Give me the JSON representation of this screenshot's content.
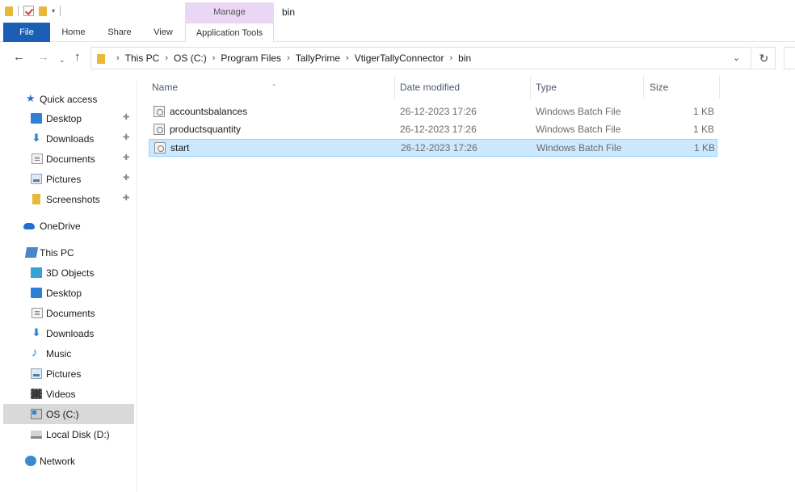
{
  "titlebar": {
    "manage_label": "Manage",
    "window_title": "bin",
    "qat_customize": "▾"
  },
  "ribbon": {
    "tabs": [
      "File",
      "Home",
      "Share",
      "View"
    ],
    "context_tab": "Application Tools",
    "accent": "#1a5fb4",
    "context_color": "#ead7f5"
  },
  "navigation": {
    "back": "←",
    "forward": "→",
    "recent": "⌄",
    "up": "↑",
    "refresh": "↻",
    "dropdown": "⌄"
  },
  "address": {
    "crumbs": [
      "This PC",
      "OS (C:)",
      "Program Files",
      "TallyPrime",
      "VtigerTallyConnector",
      "bin"
    ],
    "separator": "›"
  },
  "sidebar": {
    "quick_access": {
      "label": "Quick access",
      "items": [
        {
          "label": "Desktop",
          "icon": "desktop-icon",
          "pinned": true
        },
        {
          "label": "Downloads",
          "icon": "download-icon",
          "pinned": true
        },
        {
          "label": "Documents",
          "icon": "documents-icon",
          "pinned": true
        },
        {
          "label": "Pictures",
          "icon": "pictures-icon",
          "pinned": true
        },
        {
          "label": "Screenshots",
          "icon": "folder-icon",
          "pinned": true
        }
      ]
    },
    "onedrive": {
      "label": "OneDrive"
    },
    "this_pc": {
      "label": "This PC",
      "items": [
        {
          "label": "3D Objects",
          "icon": "3d-objects-icon"
        },
        {
          "label": "Desktop",
          "icon": "desktop-icon"
        },
        {
          "label": "Documents",
          "icon": "documents-icon"
        },
        {
          "label": "Downloads",
          "icon": "download-icon"
        },
        {
          "label": "Music",
          "icon": "music-icon"
        },
        {
          "label": "Pictures",
          "icon": "pictures-icon"
        },
        {
          "label": "Videos",
          "icon": "videos-icon"
        },
        {
          "label": "OS (C:)",
          "icon": "drive-icon",
          "selected": true
        },
        {
          "label": "Local Disk (D:)",
          "icon": "disk-icon"
        }
      ]
    },
    "network": {
      "label": "Network"
    },
    "pin_glyph": "📌"
  },
  "filelist": {
    "columns": {
      "name": "Name",
      "date": "Date modified",
      "type": "Type",
      "size": "Size"
    },
    "sort_glyph": "⌃",
    "files": [
      {
        "name": "accountsbalances",
        "date": "26-12-2023 17:26",
        "type": "Windows Batch File",
        "size": "1 KB",
        "selected": false
      },
      {
        "name": "productsquantity",
        "date": "26-12-2023 17:26",
        "type": "Windows Batch File",
        "size": "1 KB",
        "selected": false
      },
      {
        "name": "start",
        "date": "26-12-2023 17:26",
        "type": "Windows Batch File",
        "size": "1 KB",
        "selected": true
      }
    ],
    "selection_color": "#cce8ff"
  }
}
